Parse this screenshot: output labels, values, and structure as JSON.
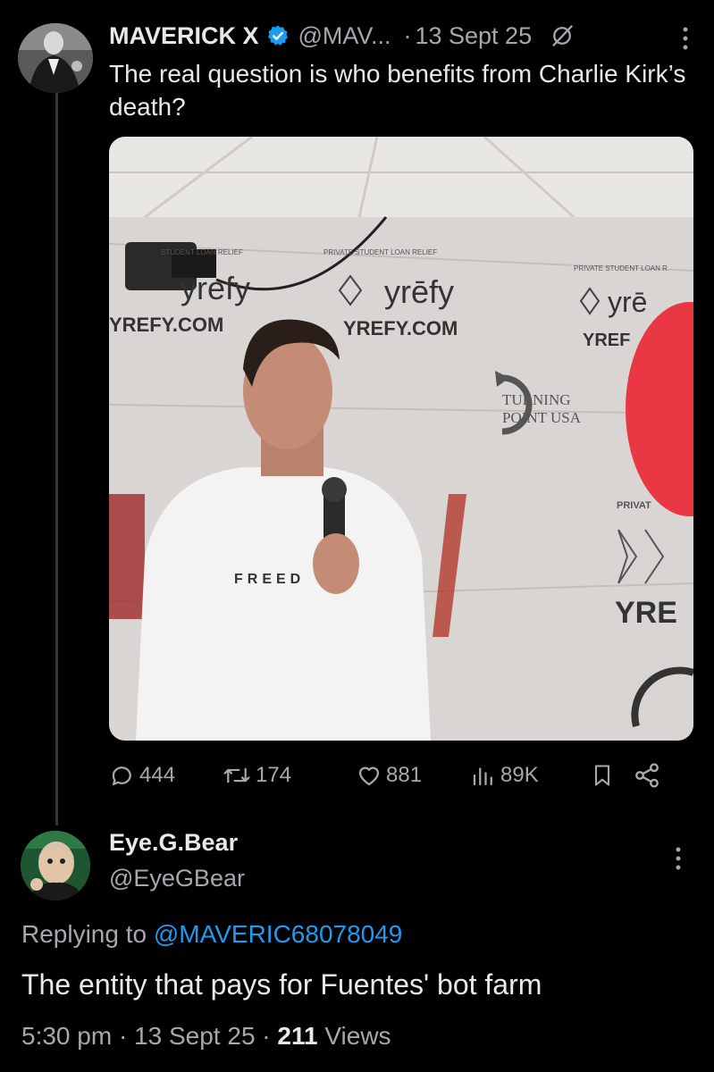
{
  "main_tweet": {
    "display_name": "MAVERICK X",
    "handle": "@MAV...",
    "separator": "·",
    "date": "13 Sept 25",
    "text": "The real question is who benefits from Charlie Kirk’s death?",
    "media": {
      "banner_texts": [
        "STUDENT LOAN RELIEF",
        "yrefy",
        "YREFY.COM",
        "PRIVATE STUDENT LOAN RELIEF",
        "yrēfy",
        "YREFY.COM",
        "PRIVATE STUDENT LOAN R",
        "yrē",
        "YREF",
        "TURNING",
        "POINT USA",
        "PRIVAT",
        "YRE",
        "FREED"
      ]
    },
    "actions": {
      "replies": "444",
      "reposts": "174",
      "likes": "881",
      "views": "89K"
    },
    "icons": [
      "verified-badge-icon",
      "grok-icon",
      "more-icon",
      "reply-icon",
      "repost-icon",
      "like-icon",
      "views-icon",
      "bookmark-icon",
      "share-icon"
    ]
  },
  "reply": {
    "display_name": "Eye.G.Bear",
    "handle": "@EyeGBear",
    "replying_prefix": "Replying to",
    "replying_to": "@MAVERIC68078049",
    "text": "The entity that pays for Fuentes' bot farm",
    "time": "5:30 pm",
    "sep1": "·",
    "date": "13 Sept 25",
    "sep2": "·",
    "views_count": "211",
    "views_label": "Views"
  },
  "colors": {
    "background": "#000000",
    "text": "#e7e9ea",
    "secondary": "#a4a9ae",
    "accent": "#1d9bf0"
  }
}
